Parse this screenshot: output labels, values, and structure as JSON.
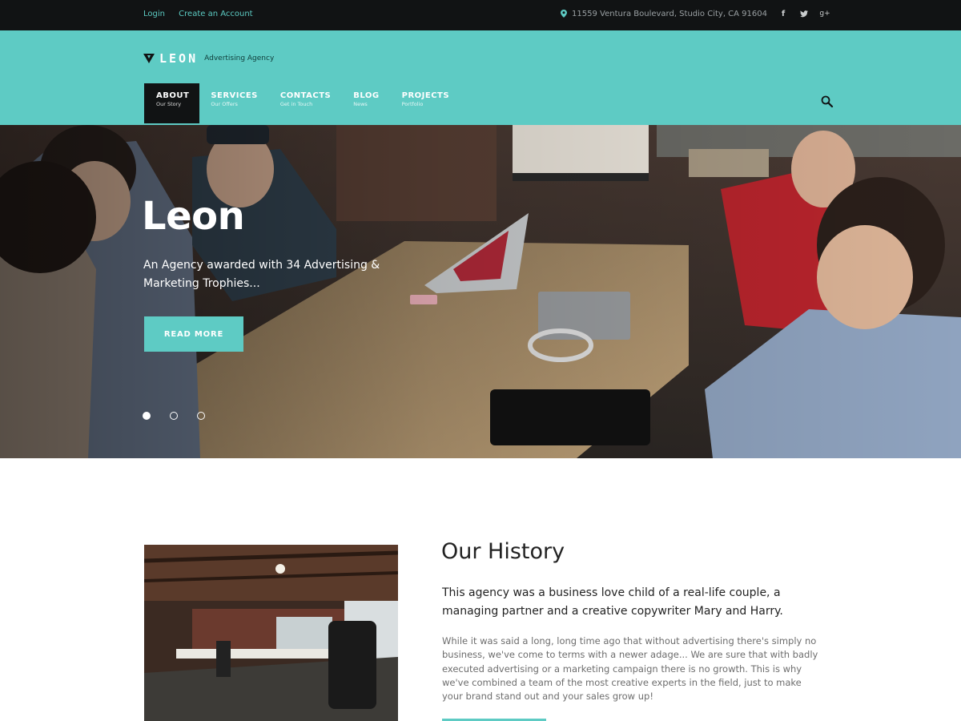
{
  "topbar": {
    "login": "Login",
    "create_account": "Create an Account",
    "address": "11559 Ventura Boulevard, Studio City, CA 91604",
    "social": [
      "facebook-icon",
      "twitter-icon",
      "google-plus-icon"
    ]
  },
  "header": {
    "logo": "LEON",
    "tagline": "Advertising Agency",
    "nav": [
      {
        "title": "ABOUT",
        "sub": "Our Story",
        "active": true
      },
      {
        "title": "SERVICES",
        "sub": "Our Offers"
      },
      {
        "title": "CONTACTS",
        "sub": "Get in Touch"
      },
      {
        "title": "BLOG",
        "sub": "News"
      },
      {
        "title": "PROJECTS",
        "sub": "Portfolio"
      }
    ]
  },
  "hero": {
    "title": "Leon",
    "subtitle": "An Agency awarded with 34 Advertising & Marketing Trophies...",
    "button": "READ MORE",
    "slides": 3,
    "active_slide": 1
  },
  "history": {
    "heading": "Our History",
    "lead": "This agency was a business love child of a real-life couple, a managing partner and a creative copywriter Mary and Harry.",
    "body": "While it was said a long, long time ago that without advertising there's simply no business, we've come to terms with a newer adage... We are sure that with badly executed advertising or a marketing campaign there is no growth. This is why we've combined a team of the most creative experts in the field, just to make your brand stand out and your sales grow up!"
  },
  "colors": {
    "accent": "#5ecbc4",
    "dark": "#111314"
  }
}
